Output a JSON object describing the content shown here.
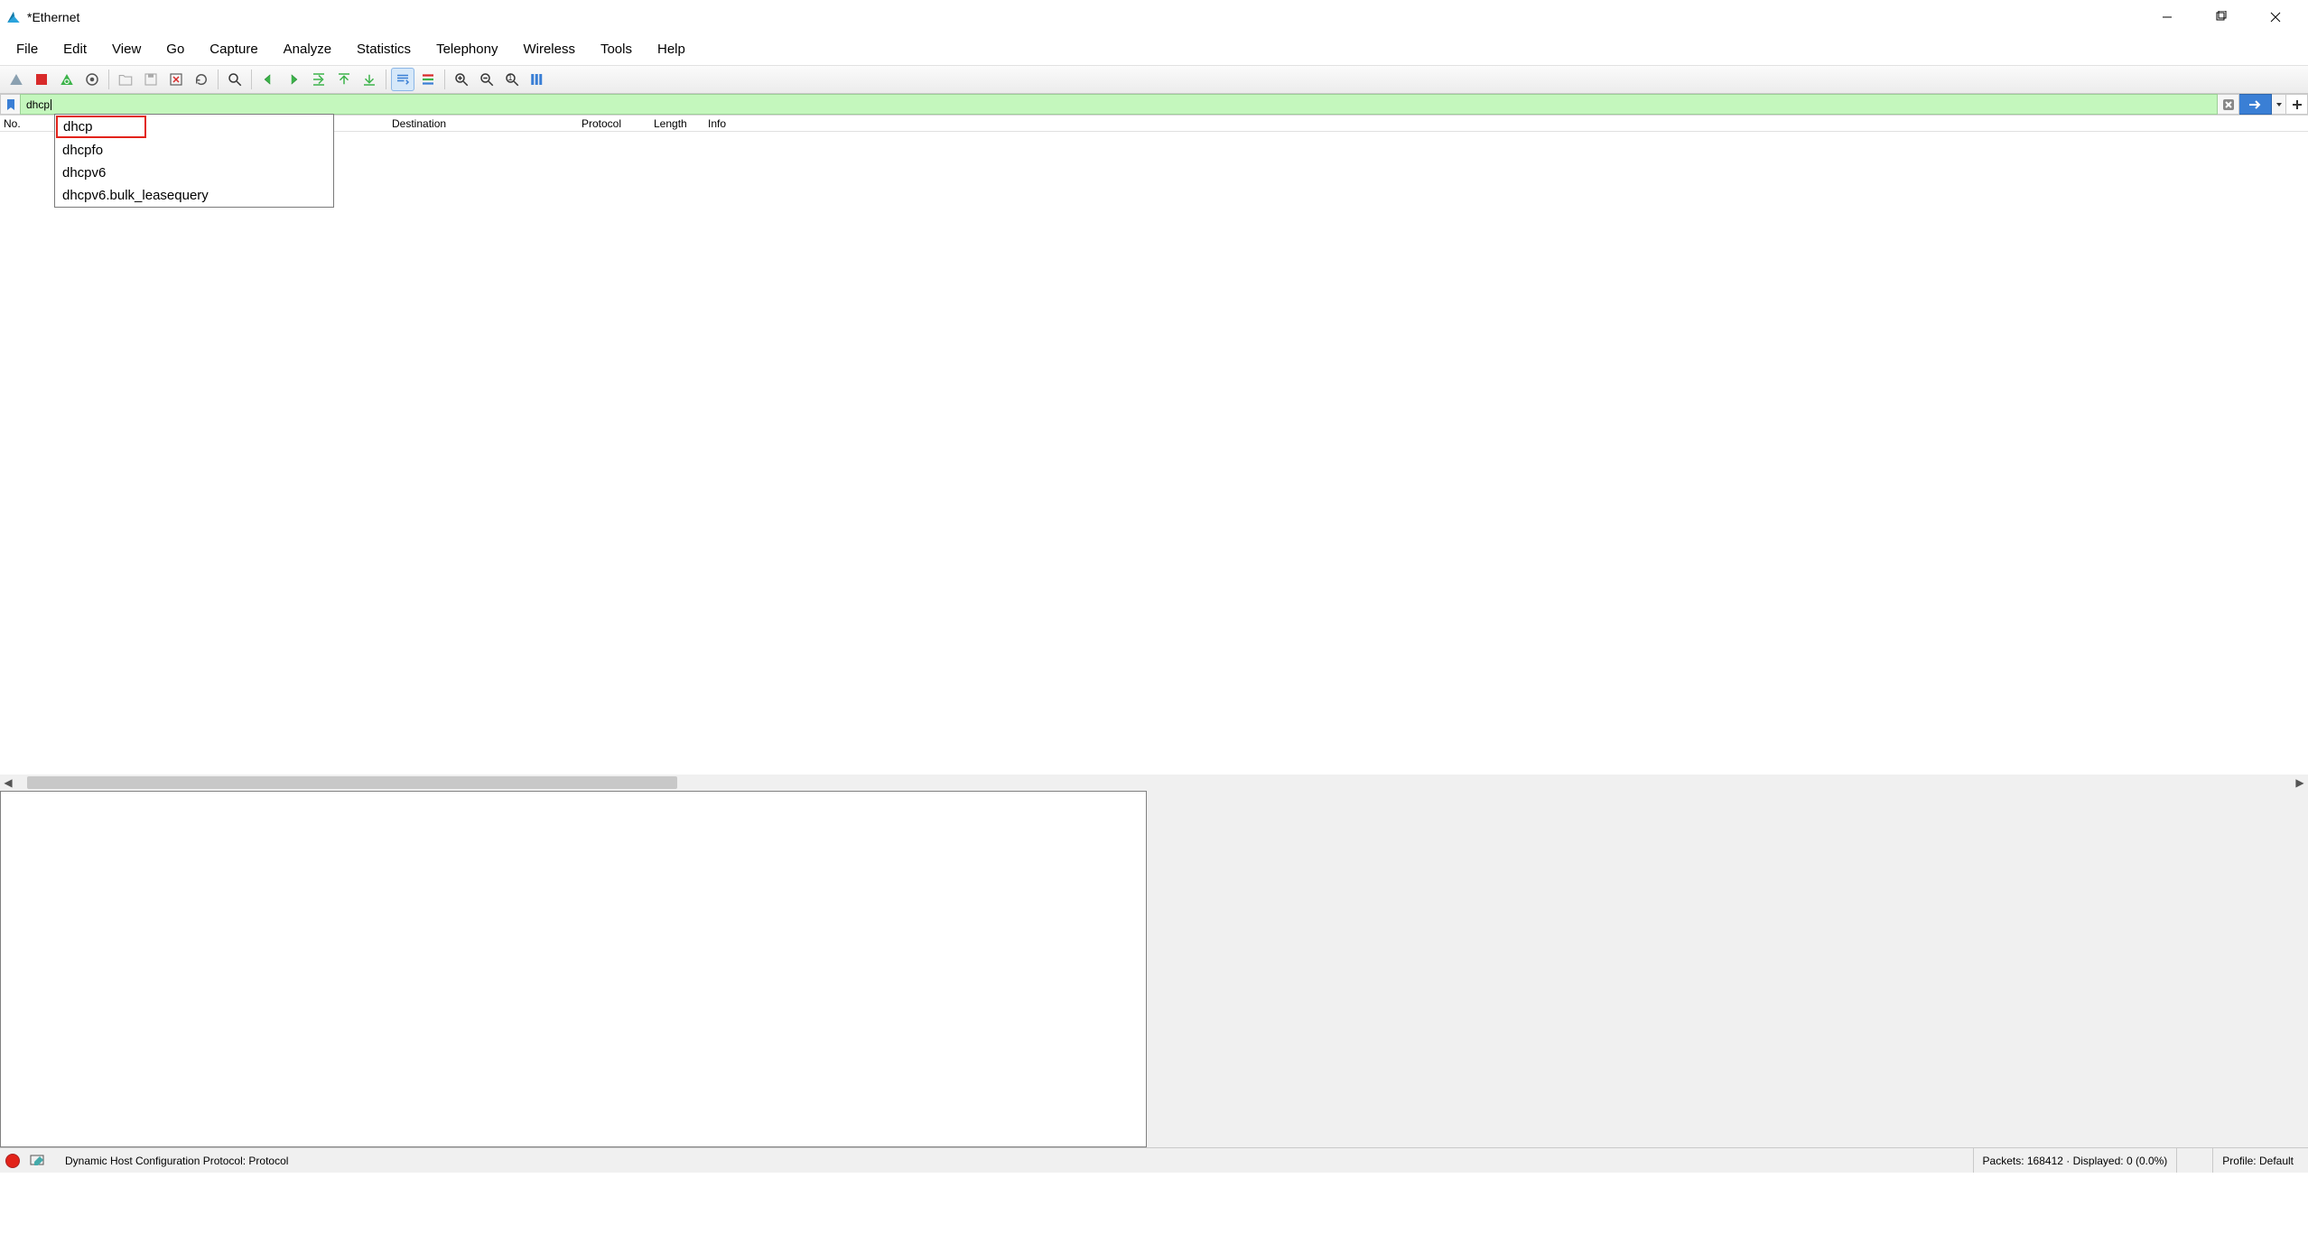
{
  "title": "*Ethernet",
  "menus": [
    "File",
    "Edit",
    "View",
    "Go",
    "Capture",
    "Analyze",
    "Statistics",
    "Telephony",
    "Wireless",
    "Tools",
    "Help"
  ],
  "filter_value": "dhcp",
  "suggestions": [
    "dhcp",
    "dhcpfo",
    "dhcpv6",
    "dhcpv6.bulk_leasequery"
  ],
  "columns": {
    "no": "No.",
    "destination": "Destination",
    "protocol": "Protocol",
    "length": "Length",
    "info": "Info"
  },
  "status": {
    "desc": "Dynamic Host Configuration Protocol: Protocol",
    "packets": "Packets: 168412 · Displayed: 0 (0.0%)",
    "profile": "Profile: Default"
  },
  "toolbar_icons": [
    "shark-fin",
    "stop",
    "restart",
    "options",
    "sep",
    "open",
    "save",
    "close",
    "reload",
    "sep",
    "find",
    "sep",
    "go-back",
    "go-forward",
    "go-to",
    "go-first",
    "go-last",
    "sep",
    "auto-scroll",
    "colorize",
    "sep",
    "zoom-in",
    "zoom-out",
    "zoom-reset",
    "resize-cols"
  ]
}
